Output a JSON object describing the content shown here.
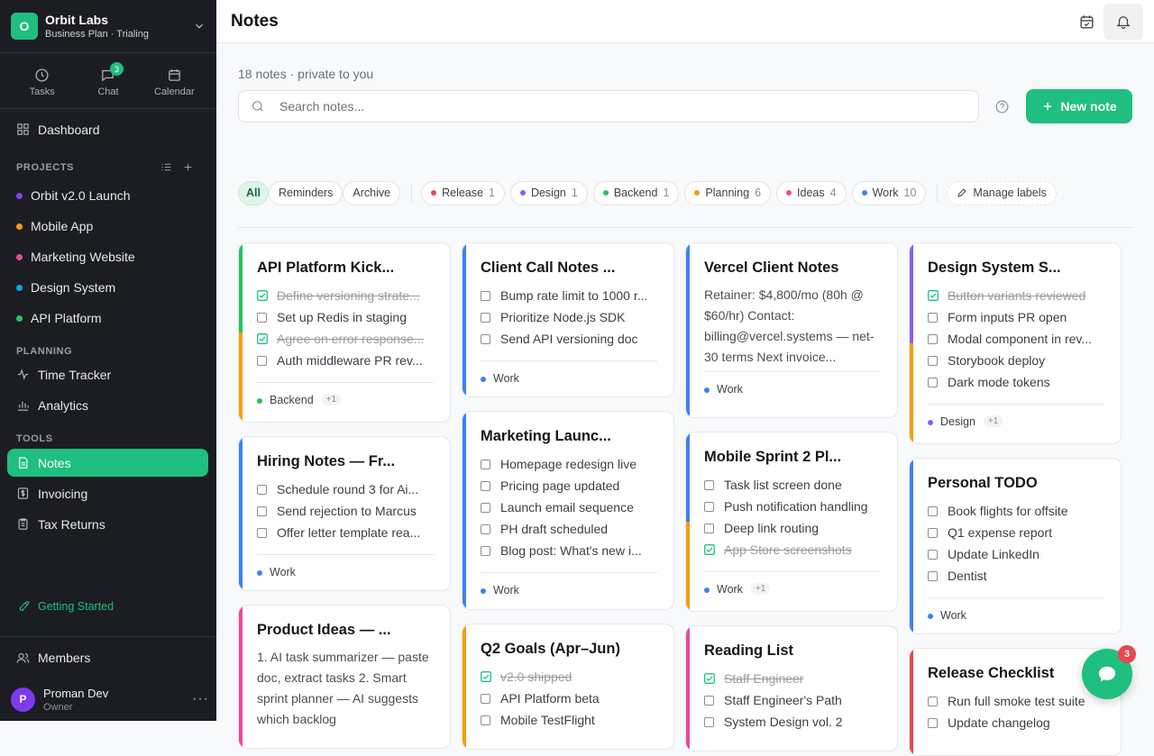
{
  "org": {
    "name": "Orbit Labs",
    "plan": "Business Plan · Trialing",
    "initial": "O"
  },
  "quick": [
    {
      "label": "Tasks",
      "icon": "clock-icon"
    },
    {
      "label": "Chat",
      "icon": "chat-icon",
      "badge": "3"
    },
    {
      "label": "Calendar",
      "icon": "calendar-icon"
    }
  ],
  "nav": {
    "dashboard": "Dashboard",
    "time_tracker": "Time Tracker",
    "analytics": "Analytics",
    "notes": "Notes",
    "invoicing": "Invoicing",
    "tax_returns": "Tax Returns",
    "members": "Members",
    "getting_started": "Getting Started"
  },
  "sections": {
    "projects": "PROJECTS",
    "planning": "PLANNING",
    "tools": "TOOLS"
  },
  "projects": [
    {
      "name": "Orbit v2.0 Launch",
      "color": "#8b3fe8"
    },
    {
      "name": "Mobile App",
      "color": "#f59e0b"
    },
    {
      "name": "Marketing Website",
      "color": "#ec4899"
    },
    {
      "name": "Design System",
      "color": "#0ea5e9"
    },
    {
      "name": "API Platform",
      "color": "#22c55e"
    }
  ],
  "user": {
    "name": "Proman Dev",
    "role": "Owner",
    "initial": "P"
  },
  "header": {
    "title": "Notes"
  },
  "main": {
    "count": "18 notes · private to you",
    "search_placeholder": "Search notes...",
    "new_note": "New note",
    "manage_labels": "Manage labels"
  },
  "views": [
    "All",
    "Reminders",
    "Archive"
  ],
  "labels": [
    {
      "name": "Release",
      "count": "1",
      "color": "#e5484d"
    },
    {
      "name": "Design",
      "count": "1",
      "color": "#8b5cf6"
    },
    {
      "name": "Backend",
      "count": "1",
      "color": "#22c55e"
    },
    {
      "name": "Planning",
      "count": "6",
      "color": "#f59e0b"
    },
    {
      "name": "Ideas",
      "count": "4",
      "color": "#ec4899"
    },
    {
      "name": "Work",
      "count": "10",
      "color": "#3b82f6"
    }
  ],
  "notes": [
    {
      "title": "API Platform Kick...",
      "items": [
        {
          "text": "Define versioning strate...",
          "done": true
        },
        {
          "text": "Set up Redis in staging",
          "done": false
        },
        {
          "text": "Agree on error response...",
          "done": true
        },
        {
          "text": "Auth middleware PR rev...",
          "done": false
        }
      ],
      "label": "Backend",
      "more": "+1"
    },
    {
      "title": "Hiring Notes — Fr...",
      "items": [
        {
          "text": "Schedule round 3 for Ai...",
          "done": false
        },
        {
          "text": "Send rejection to Marcus",
          "done": false
        },
        {
          "text": "Offer letter template rea...",
          "done": false
        }
      ],
      "label": "Work"
    },
    {
      "title": "Product Ideas — ...",
      "body": "1. AI task summarizer — paste doc, extract tasks 2. Smart sprint planner — AI suggests which backlog"
    },
    {
      "title": "Client Call Notes ...",
      "items": [
        {
          "text": "Bump rate limit to 1000 r...",
          "done": false
        },
        {
          "text": "Prioritize Node.js SDK",
          "done": false
        },
        {
          "text": "Send API versioning doc",
          "done": false
        }
      ],
      "label": "Work"
    },
    {
      "title": "Marketing Launc...",
      "items": [
        {
          "text": "Homepage redesign live",
          "done": false
        },
        {
          "text": "Pricing page updated",
          "done": false
        },
        {
          "text": "Launch email sequence",
          "done": false
        },
        {
          "text": "PH draft scheduled",
          "done": false
        },
        {
          "text": "Blog post: What's new i...",
          "done": false
        }
      ],
      "label": "Work"
    },
    {
      "title": "Q2 Goals (Apr–Jun)",
      "items": [
        {
          "text": "v2.0 shipped",
          "done": true
        },
        {
          "text": "API Platform beta",
          "done": false
        },
        {
          "text": "Mobile TestFlight",
          "done": false
        }
      ]
    },
    {
      "title": "Vercel Client Notes",
      "body": "Retainer: $4,800/mo (80h @ $60/hr) Contact: billing@vercel.systems — net-30 terms Next invoice...",
      "label": "Work"
    },
    {
      "title": "Mobile Sprint 2 Pl...",
      "items": [
        {
          "text": "Task list screen done",
          "done": false
        },
        {
          "text": "Push notification handling",
          "done": false
        },
        {
          "text": "Deep link routing",
          "done": false
        },
        {
          "text": "App Store screenshots",
          "done": true
        }
      ],
      "label": "Work",
      "more": "+1"
    },
    {
      "title": "Reading List",
      "items": [
        {
          "text": "Staff Engineer",
          "done": true
        },
        {
          "text": "Staff Engineer's Path",
          "done": false
        },
        {
          "text": "System Design vol. 2",
          "done": false
        }
      ]
    },
    {
      "title": "Design System S...",
      "items": [
        {
          "text": "Button variants reviewed",
          "done": true
        },
        {
          "text": "Form inputs PR open",
          "done": false
        },
        {
          "text": "Modal component in rev...",
          "done": false
        },
        {
          "text": "Storybook deploy",
          "done": false
        },
        {
          "text": "Dark mode tokens",
          "done": false
        }
      ],
      "label": "Design",
      "more": "+1"
    },
    {
      "title": "Personal TODO",
      "items": [
        {
          "text": "Book flights for offsite",
          "done": false
        },
        {
          "text": "Q1 expense report",
          "done": false
        },
        {
          "text": "Update LinkedIn",
          "done": false
        },
        {
          "text": "Dentist",
          "done": false
        }
      ],
      "label": "Work"
    },
    {
      "title": "Release Checklist",
      "items": [
        {
          "text": "Run full smoke test suite",
          "done": false
        },
        {
          "text": "Update changelog",
          "done": false
        }
      ]
    }
  ],
  "fab": {
    "badge": "3"
  },
  "colors": {
    "accent": "#1fbf7f",
    "sidebar": "#1b1d22",
    "work": "#3b82f6",
    "backend": "#22c55e",
    "design": "#8b5cf6",
    "planning": "#f59e0b",
    "ideas": "#ec4899",
    "release": "#e5484d"
  }
}
